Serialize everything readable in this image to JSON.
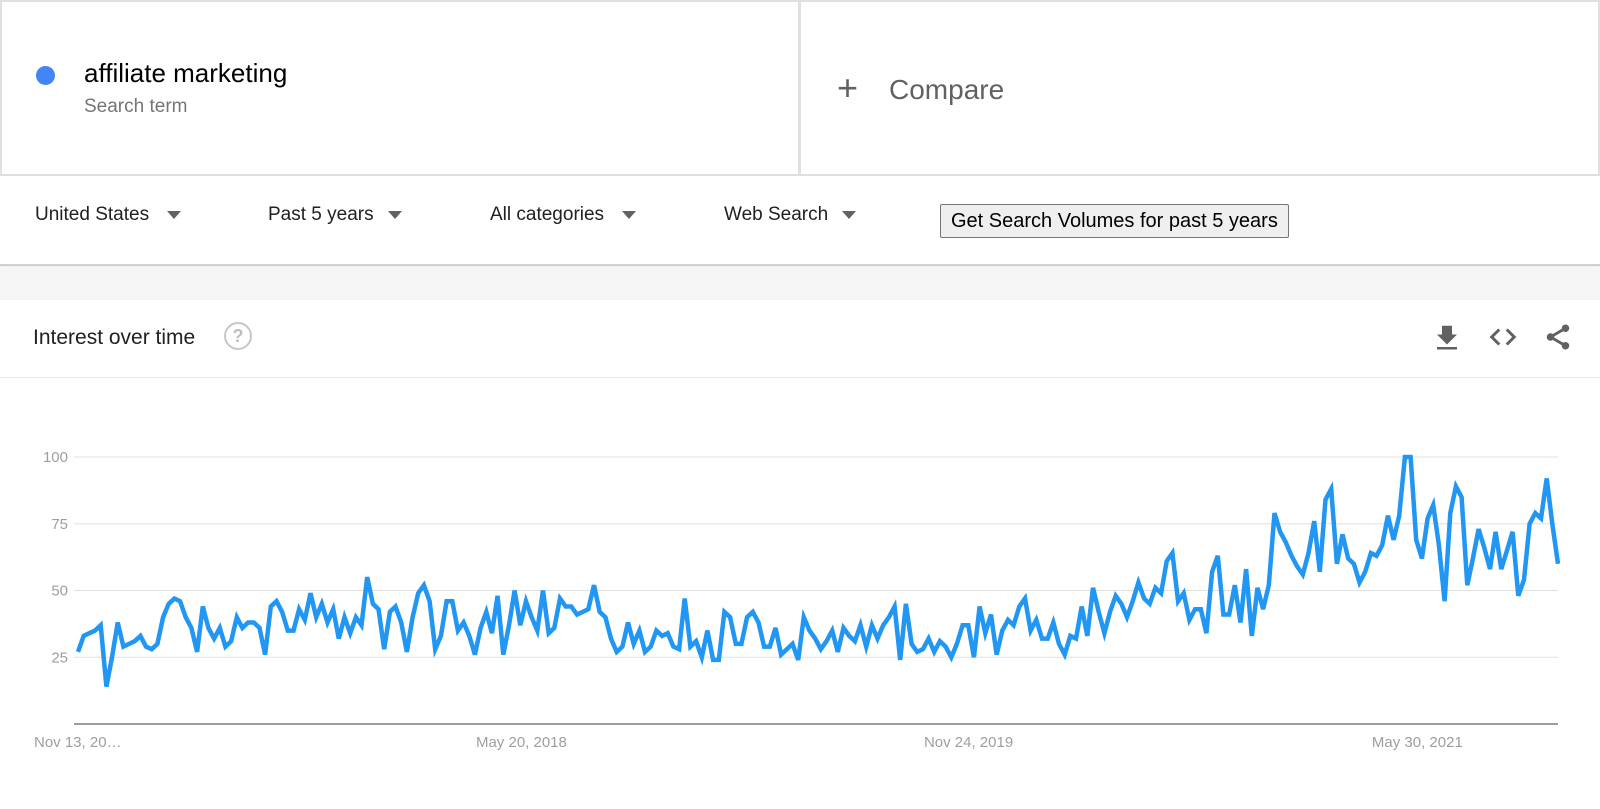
{
  "search_term": {
    "name": "affiliate marketing",
    "type": "Search term",
    "color": "#4285f4"
  },
  "compare": {
    "icon": "plus-icon",
    "label": "Compare"
  },
  "filters": {
    "region": "United States",
    "time_range": "Past 5 years",
    "category": "All categories",
    "search_type": "Web Search",
    "volume_button": "Get Search Volumes for past 5 years"
  },
  "card": {
    "title": "Interest over time",
    "help_icon": "help-circle-icon",
    "actions": [
      "download-icon",
      "embed-code-icon",
      "share-icon"
    ]
  },
  "chart_data": {
    "type": "line",
    "title": "Interest over time",
    "xlabel": "",
    "ylabel": "",
    "ylim": [
      0,
      100
    ],
    "yticks": [
      25,
      50,
      75,
      100
    ],
    "ytick_labels": [
      "25",
      "50",
      "75",
      "100"
    ],
    "xtick_labels": [
      "Nov 13, 20…",
      "May 20, 2018",
      "Nov 24, 2019",
      "May 30, 2021"
    ],
    "xtick_positions": [
      0,
      79,
      158,
      237
    ],
    "grid": true,
    "legend": "none",
    "series": [
      {
        "name": "affiliate marketing",
        "color": "#2196f3",
        "values": [
          27,
          33,
          34,
          35,
          37,
          14,
          25,
          38,
          29,
          30,
          31,
          33,
          29,
          28,
          30,
          40,
          45,
          47,
          46,
          40,
          36,
          27,
          44,
          36,
          32,
          36,
          29,
          31,
          40,
          36,
          38,
          38,
          36,
          26,
          44,
          46,
          42,
          35,
          35,
          43,
          39,
          49,
          40,
          45,
          38,
          43,
          32,
          40,
          34,
          40,
          37,
          55,
          45,
          43,
          28,
          42,
          44,
          38,
          27,
          40,
          49,
          52,
          46,
          28,
          33,
          46,
          46,
          35,
          38,
          33,
          26,
          36,
          42,
          34,
          48,
          26,
          37,
          50,
          37,
          46,
          40,
          35,
          50,
          34,
          36,
          47,
          44,
          44,
          41,
          42,
          43,
          52,
          42,
          40,
          32,
          27,
          29,
          38,
          30,
          35,
          27,
          29,
          35,
          33,
          34,
          29,
          28,
          47,
          29,
          31,
          25,
          35,
          24,
          24,
          42,
          40,
          30,
          30,
          40,
          42,
          38,
          29,
          29,
          36,
          26,
          28,
          30,
          24,
          40,
          35,
          32,
          28,
          31,
          35,
          27,
          36,
          33,
          31,
          37,
          29,
          37,
          32,
          37,
          40,
          44,
          24,
          45,
          30,
          27,
          28,
          32,
          27,
          31,
          29,
          25,
          30,
          37,
          37,
          25,
          44,
          34,
          41,
          26,
          35,
          39,
          37,
          44,
          47,
          35,
          39,
          32,
          32,
          38,
          30,
          26,
          33,
          32,
          44,
          33,
          51,
          42,
          34,
          42,
          48,
          45,
          40,
          46,
          53,
          47,
          45,
          51,
          49,
          61,
          64,
          46,
          49,
          39,
          43,
          43,
          34,
          57,
          63,
          41,
          41,
          52,
          38,
          58,
          33,
          51,
          43,
          52,
          79,
          72,
          68,
          63,
          59,
          56,
          64,
          76,
          57,
          84,
          88,
          60,
          71,
          62,
          60,
          53,
          57,
          64,
          63,
          67,
          78,
          69,
          78,
          100,
          100,
          69,
          62,
          77,
          82,
          67,
          46,
          79,
          89,
          85,
          52,
          62,
          73,
          66,
          58,
          72,
          58,
          65,
          72,
          48,
          54,
          75,
          79,
          77,
          92,
          75,
          60
        ]
      }
    ]
  }
}
